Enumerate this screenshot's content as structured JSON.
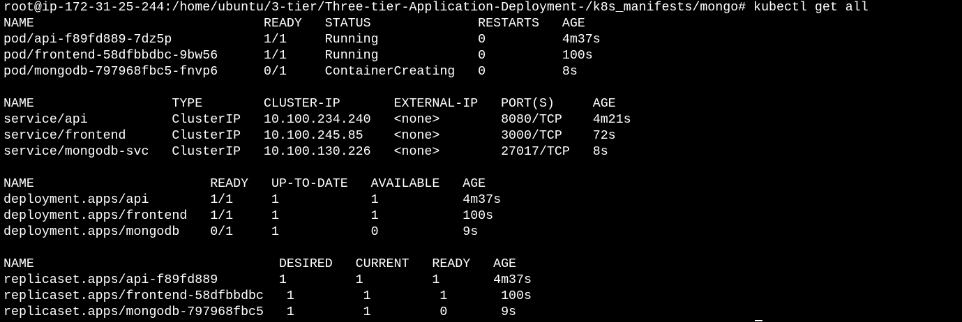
{
  "terminal": {
    "background": "#000000",
    "foreground": "#ffffff",
    "lines": [
      "root@ip-172-31-25-244:/home/ubuntu/3-tier/Three-tier-Application-Deployment-/k8s_manifests/mongo# kubectl get all",
      "NAME                              READY   STATUS              RESTARTS   AGE",
      "pod/api-f89fd889-7dz5p            1/1     Running             0          4m37s",
      "pod/frontend-58dfbbdbc-9bw56      1/1     Running             0          100s",
      "pod/mongodb-797968fbc5-fnvp6      0/1     ContainerCreating   0          8s",
      "",
      "NAME                  TYPE        CLUSTER-IP       EXTERNAL-IP   PORT(S)     AGE",
      "service/api           ClusterIP   10.100.234.240   <none>        8080/TCP    4m21s",
      "service/frontend      ClusterIP   10.100.245.85    <none>        3000/TCP    72s",
      "service/mongodb-svc   ClusterIP   10.100.130.226   <none>        27017/TCP   8s",
      "",
      "NAME                       READY   UP-TO-DATE   AVAILABLE   AGE",
      "deployment.apps/api        1/1     1            1           4m37s",
      "deployment.apps/frontend   1/1     1            1           100s",
      "deployment.apps/mongodb    0/1     1            0           9s",
      "",
      "NAME                                DESIRED   CURRENT   READY   AGE",
      "replicaset.apps/api-f89fd889        1         1         1       4m37s",
      "replicaset.apps/frontend-58dfbbdbc   1         1         1       100s",
      "replicaset.apps/mongodb-797968fbc5   1         1         0       9s"
    ]
  }
}
